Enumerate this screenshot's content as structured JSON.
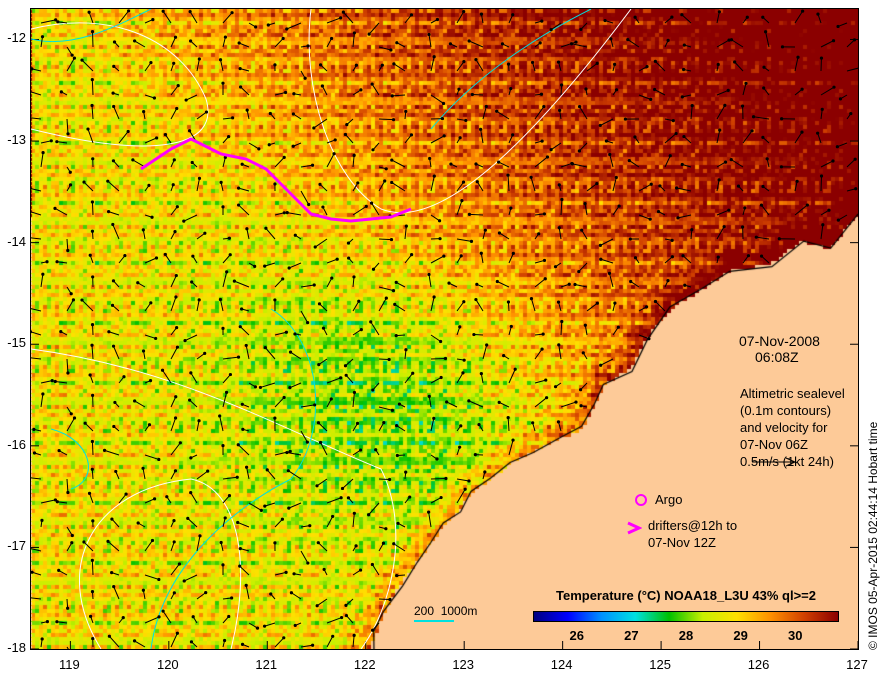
{
  "map": {
    "date": "07-Nov-2008",
    "time": "06:08Z",
    "altimetry_note": [
      "Altimetric sealevel",
      "(0.1m contours)",
      "and velocity for",
      "07-Nov 06Z",
      "0.5m/s (1kt 24h)"
    ],
    "argo_label": "Argo",
    "drifters_label": [
      "drifters@12h to",
      "07-Nov 12Z"
    ],
    "depth_scale_label": "200  1000m",
    "credit": "© IMOS 05-Apr-2015 02:44:14 Hobart time",
    "lat_ticks": [
      "-12",
      "-13",
      "-14",
      "-15",
      "-16",
      "-17",
      "-18"
    ],
    "lon_ticks": [
      "119",
      "120",
      "121",
      "122",
      "123",
      "124",
      "125",
      "126",
      "127"
    ],
    "lon_range": [
      118.6,
      127
    ],
    "lat_range": [
      -18,
      -11.7
    ],
    "colors": {
      "land": "#fdca98",
      "argo": "#ff00ff",
      "drifter": "#ff00ff",
      "contour_200m": "#00e0e0",
      "contour_sealevel": "#ffffff"
    }
  },
  "colorbar": {
    "title": "Temperature (°C) NOAA18_L3U 43% ql>=2",
    "ticks": [
      "26",
      "27",
      "28",
      "29",
      "30"
    ],
    "range": [
      25.2,
      30.8
    ],
    "colormap": [
      "#00007f",
      "#0000ff",
      "#0090ff",
      "#00e0e0",
      "#00c000",
      "#c8f000",
      "#ffe000",
      "#ff9000",
      "#d04000",
      "#8b0000"
    ]
  }
}
